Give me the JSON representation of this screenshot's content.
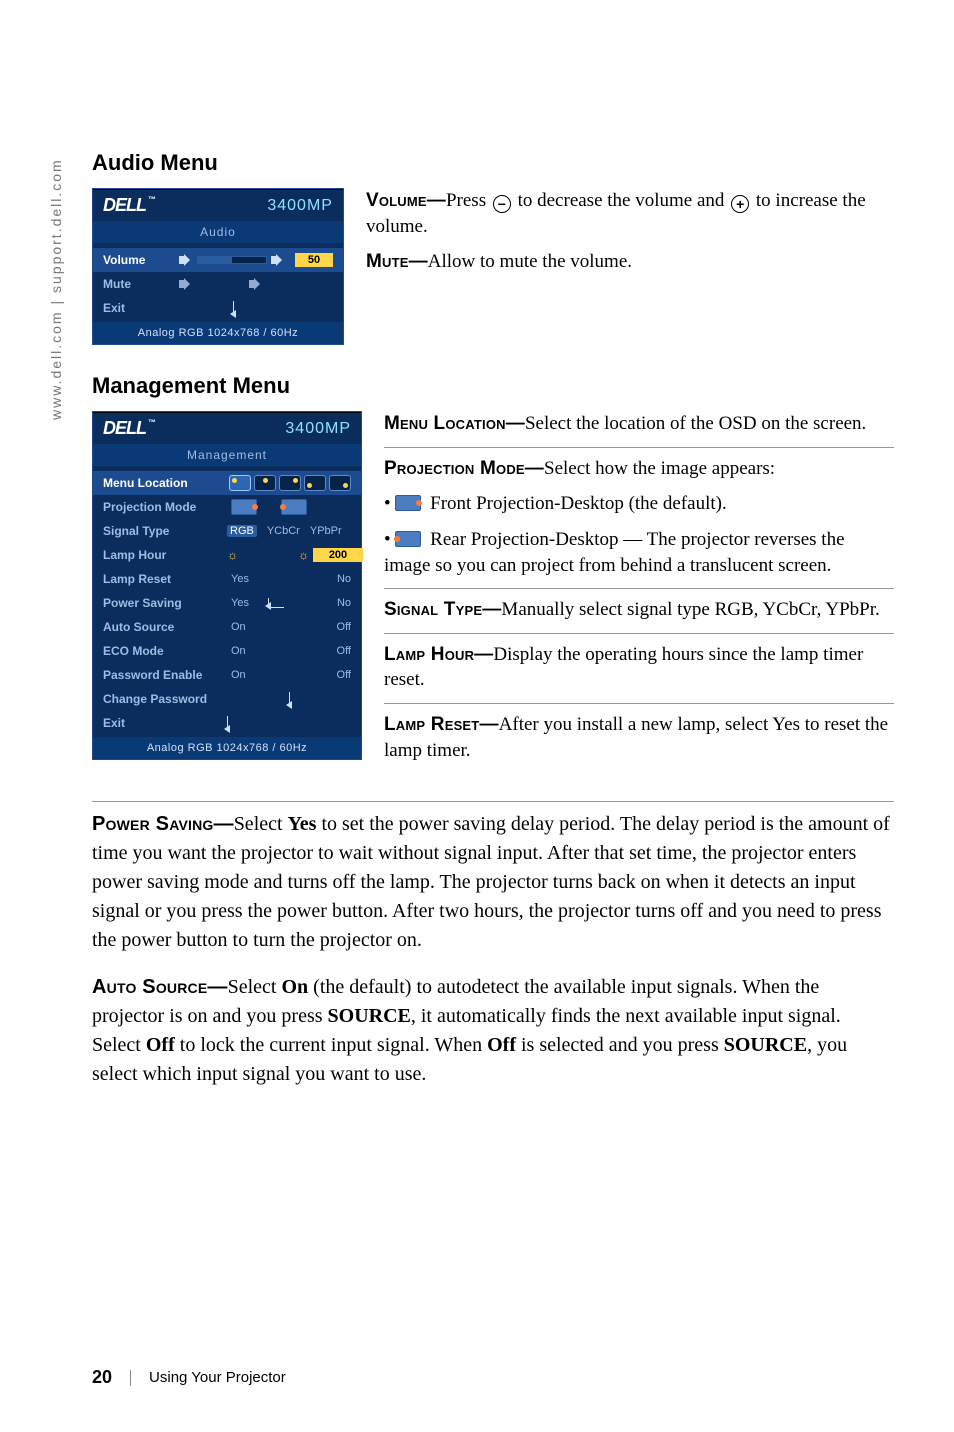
{
  "side_url": "www.dell.com | support.dell.com",
  "sections": {
    "audio_title": "Audio Menu",
    "mgmt_title": "Management Menu"
  },
  "osd_common": {
    "brand": "DELL",
    "tm": "™",
    "model": "3400MP",
    "footer": "Analog RGB 1024x768 / 60Hz"
  },
  "osd_audio": {
    "title": "Audio",
    "rows": {
      "volume_label": "Volume",
      "volume_value": "50",
      "mute_label": "Mute",
      "exit_label": "Exit"
    }
  },
  "osd_mgmt": {
    "title": "Management",
    "rows": {
      "menu_location": "Menu Location",
      "projection_mode": "Projection Mode",
      "signal_type": "Signal Type",
      "signal_opts": {
        "a": "RGB",
        "b": "YCbCr",
        "c": "YPbPr"
      },
      "lamp_hour": "Lamp Hour",
      "lamp_hour_value": "200",
      "lamp_reset": "Lamp Reset",
      "lamp_reset_yes": "Yes",
      "lamp_reset_no": "No",
      "power_saving": "Power Saving",
      "power_saving_yes": "Yes",
      "power_saving_no": "No",
      "auto_source": "Auto Source",
      "auto_source_on": "On",
      "auto_source_off": "Off",
      "eco_mode": "ECO Mode",
      "eco_mode_on": "On",
      "eco_mode_off": "Off",
      "password_enable": "Password Enable",
      "password_enable_on": "On",
      "password_enable_off": "Off",
      "change_password": "Change Password",
      "exit": "Exit"
    }
  },
  "desc_audio": {
    "volume_term": "Volume—",
    "volume_text_a": "Press ",
    "volume_minus": "−",
    "volume_text_b": " to decrease the volume and ",
    "volume_plus": "+",
    "volume_text_c": " to increase the volume.",
    "mute_term": "Mute—",
    "mute_text": "Allow to mute the volume."
  },
  "desc_mgmt": {
    "menu_loc_term": "Menu Location—",
    "menu_loc_text": "Select the location of the OSD on the screen.",
    "proj_mode_term": "Projection Mode—",
    "proj_mode_text": "Select how the image appears:",
    "front_text": " Front Projection-Desktop (the default).",
    "rear_text_a": " Rear Projection-Desktop — The projector reverses the image so you can project from behind a translucent screen.",
    "signal_term": "Signal Type—",
    "signal_text": "Manually select signal type RGB, YCbCr, YPbPr.",
    "lamp_hour_term": "Lamp Hour—",
    "lamp_hour_text": "Display the operating hours since the lamp timer reset.",
    "lamp_reset_term": "Lamp Reset—",
    "lamp_reset_text": "After you install a new lamp, select Yes to reset the lamp timer."
  },
  "body": {
    "power_saving_term": "Power Saving—",
    "power_saving_text_a": "Select ",
    "power_saving_yes": "Yes",
    "power_saving_text_b": " to set the power saving delay period. The delay period is the amount of time you want the projector to wait without signal input. After that set time, the projector enters power saving mode and turns off the lamp. The projector turns back on when it detects an input signal or you press the power button. After two hours, the projector turns off and you need to press the power button to turn the projector on.",
    "auto_source_term": "Auto Source—",
    "auto_source_text_a": "Select ",
    "auto_source_on": "On",
    "auto_source_text_b": " (the default) to autodetect the available input signals. When the projector is on and you press ",
    "source_kw": "SOURCE",
    "auto_source_text_c": ", it automatically finds the next available input signal. Select ",
    "auto_source_off": "Off",
    "auto_source_text_d": " to lock the current input signal. When ",
    "auto_source_off2": "Off",
    "auto_source_text_e": " is selected and you press ",
    "source_kw2": "SOURCE",
    "auto_source_text_f": ", you select which input signal you want to use."
  },
  "footer": {
    "page": "20",
    "chapter": "Using Your Projector"
  }
}
